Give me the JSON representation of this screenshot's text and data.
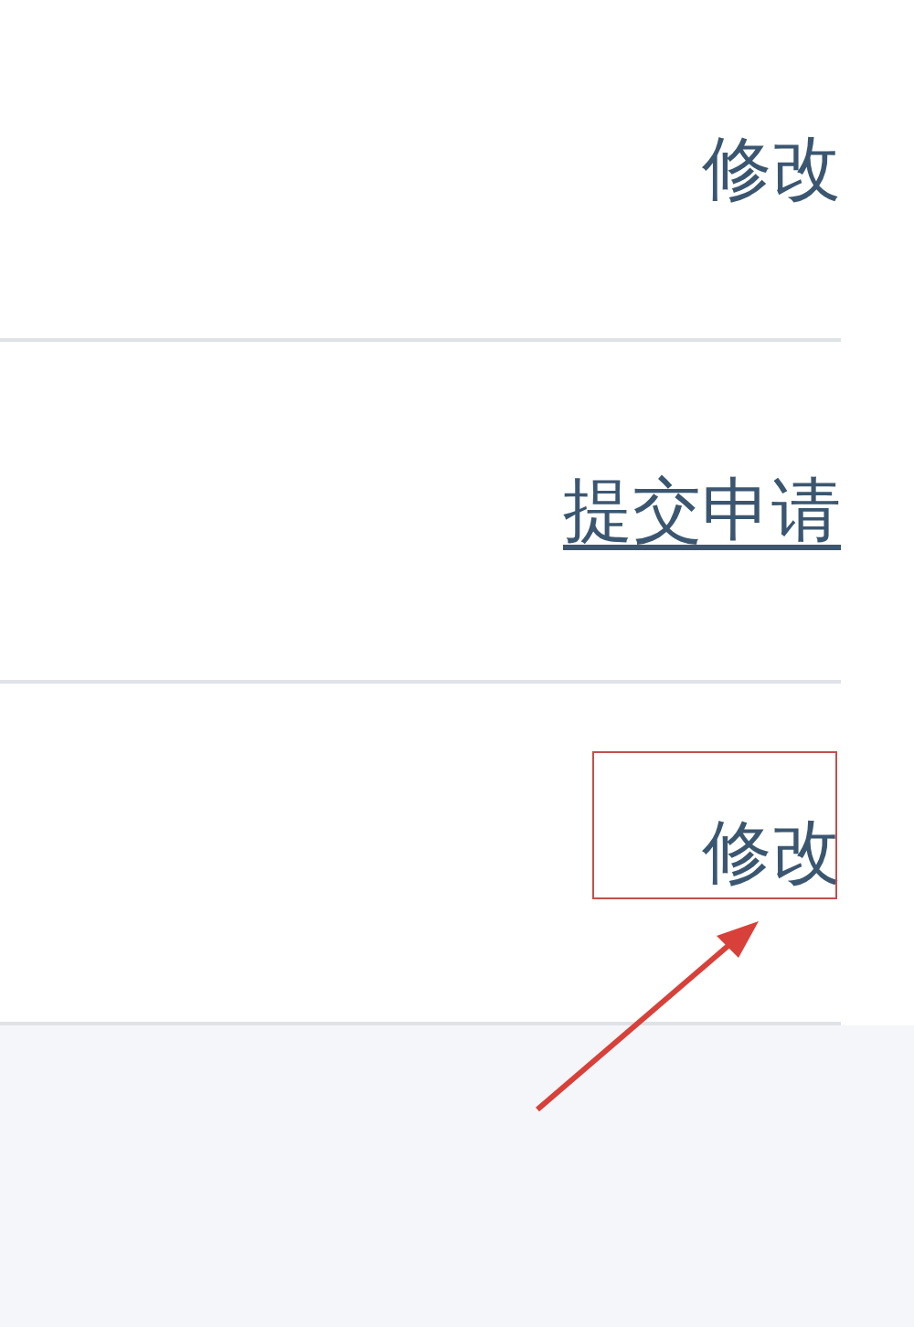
{
  "rows": [
    {
      "link": "修改",
      "underlined": false,
      "highlighted": false
    },
    {
      "link": "提交申请",
      "underlined": true,
      "highlighted": false
    },
    {
      "link": "修改",
      "underlined": false,
      "highlighted": true
    }
  ]
}
